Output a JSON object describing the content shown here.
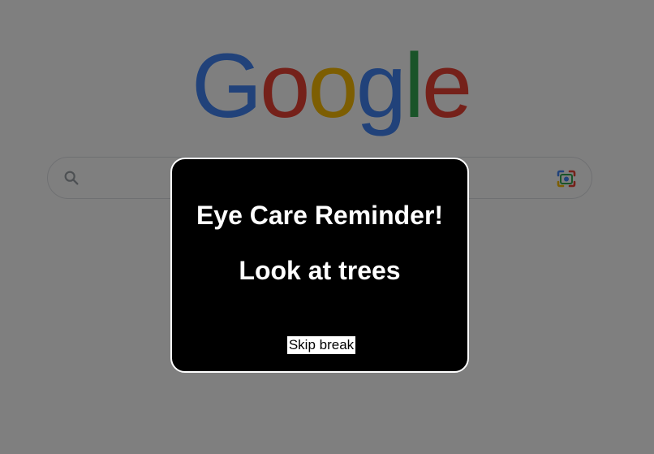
{
  "logo": {
    "letters": [
      {
        "char": "G",
        "color": "#4285F4"
      },
      {
        "char": "o",
        "color": "#EA4335"
      },
      {
        "char": "o",
        "color": "#FBBC05"
      },
      {
        "char": "g",
        "color": "#4285F4"
      },
      {
        "char": "l",
        "color": "#34A853"
      },
      {
        "char": "e",
        "color": "#EA4335"
      }
    ]
  },
  "search": {
    "value": "",
    "placeholder": "",
    "icon": "search-icon",
    "lens_icon": "google-lens-icon"
  },
  "reminder": {
    "title": "Eye Care Reminder!",
    "message": "Look at trees",
    "skip_label": "Skip break"
  },
  "colors": {
    "overlay": "rgba(0,0,0,0.5)",
    "modal_background": "#000000",
    "modal_border": "#ffffff",
    "modal_text": "#ffffff"
  }
}
